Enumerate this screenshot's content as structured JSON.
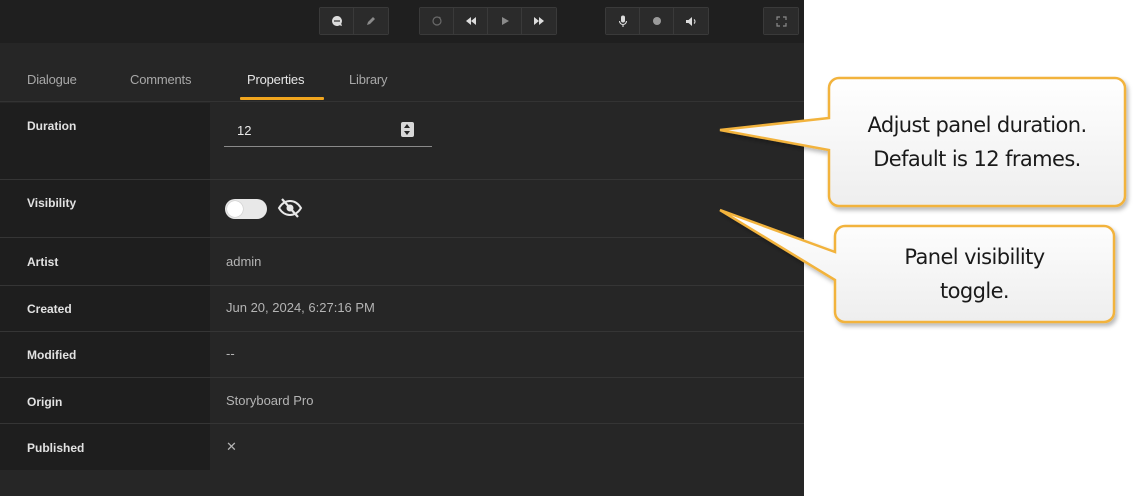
{
  "toolbar": {
    "buttons": [
      {
        "icon": "comment-icon"
      },
      {
        "icon": "pencil-icon"
      },
      {
        "icon": "loop-icon"
      },
      {
        "icon": "rewind-icon"
      },
      {
        "icon": "play-icon"
      },
      {
        "icon": "fast-forward-icon"
      },
      {
        "icon": "microphone-icon"
      },
      {
        "icon": "record-icon"
      },
      {
        "icon": "volume-icon"
      },
      {
        "icon": "fullscreen-icon"
      }
    ]
  },
  "tabs": [
    {
      "label": "Dialogue"
    },
    {
      "label": "Comments"
    },
    {
      "label": "Properties",
      "active": true
    },
    {
      "label": "Library"
    }
  ],
  "properties": {
    "duration": {
      "label": "Duration",
      "value": "12"
    },
    "visibility": {
      "label": "Visibility",
      "toggle_on": false,
      "icon": "eye-slash-icon"
    },
    "artist": {
      "label": "Artist",
      "value": "admin"
    },
    "created": {
      "label": "Created",
      "value": "Jun 20, 2024, 6:27:16 PM"
    },
    "modified": {
      "label": "Modified",
      "value": "--"
    },
    "origin": {
      "label": "Origin",
      "value": "Storyboard Pro"
    },
    "published": {
      "label": "Published",
      "value": "✕"
    }
  },
  "callouts": {
    "duration": {
      "line1": "Adjust panel duration.",
      "line2": "Default is 12 frames."
    },
    "visibility": {
      "line1": "Panel visibility",
      "line2": "toggle."
    }
  },
  "colors": {
    "accent": "#f0a51e",
    "callout_border": "#f2b33d",
    "panel_bg": "#262626"
  }
}
